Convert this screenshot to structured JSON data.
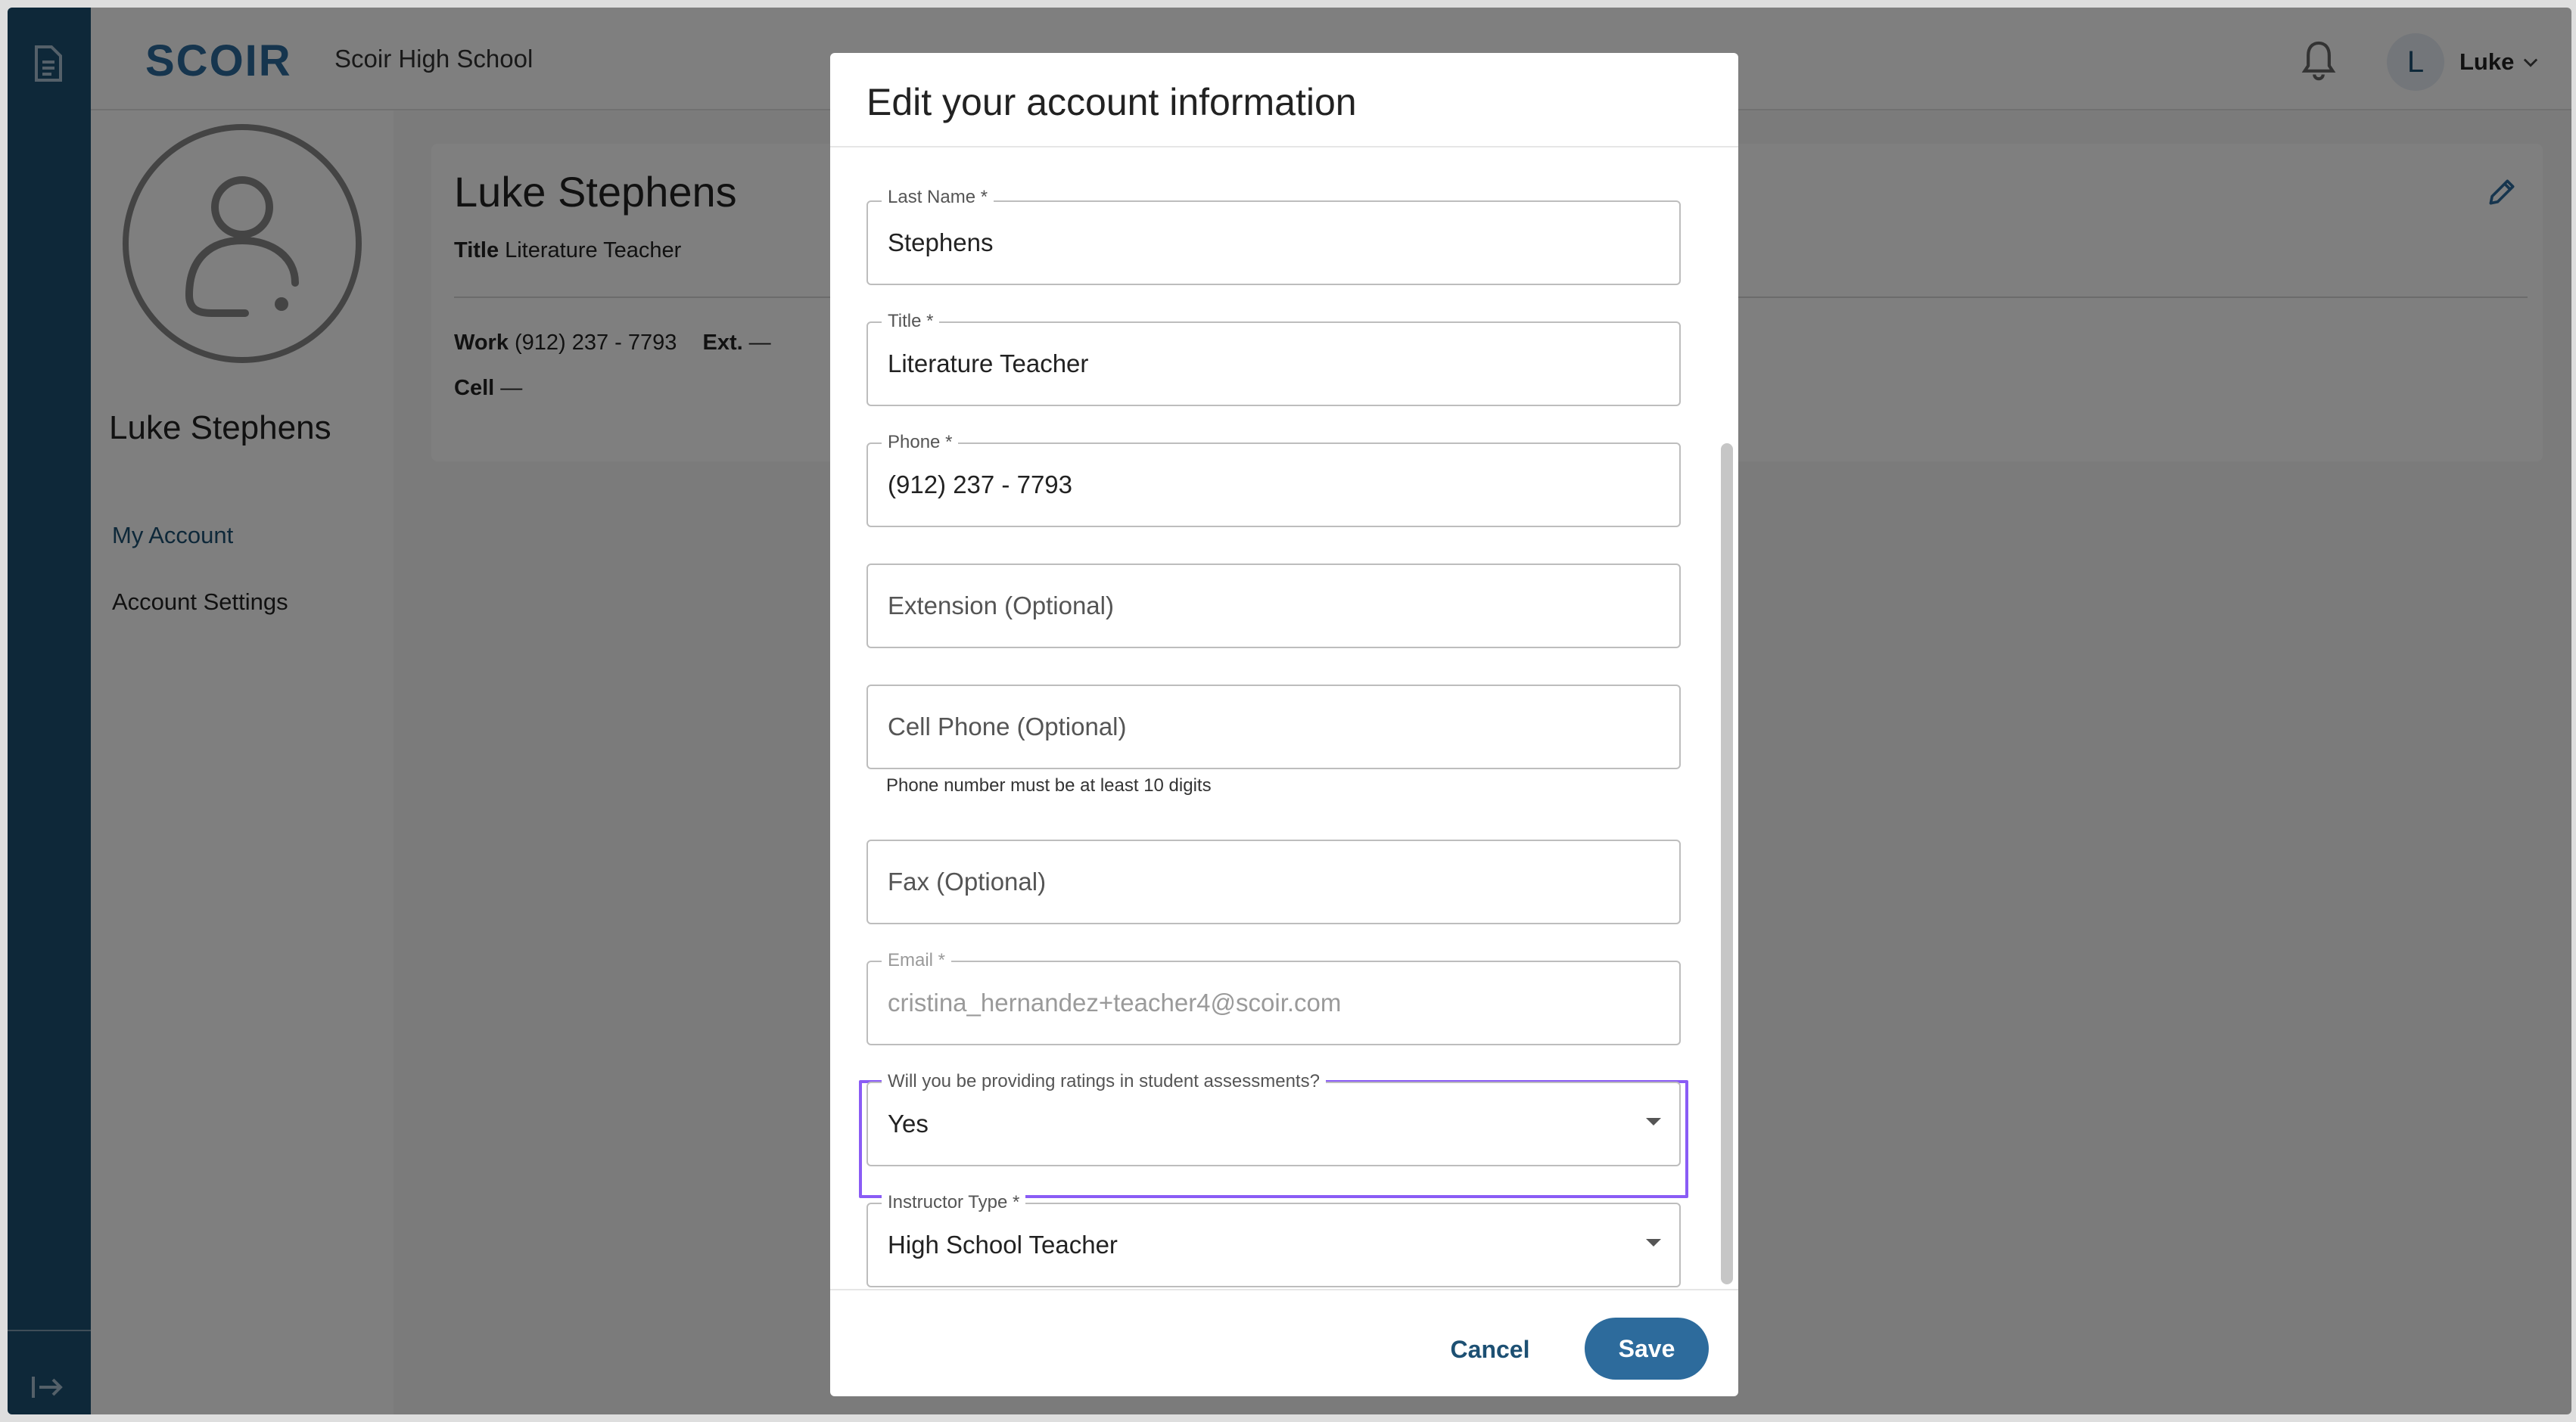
{
  "header": {
    "logo": "SCOIR",
    "school": "Scoir High School",
    "user_initial": "L",
    "user_name": "Luke"
  },
  "profile": {
    "name": "Luke Stephens"
  },
  "nav": {
    "items": [
      {
        "label": "My Account"
      },
      {
        "label": "Account Settings"
      }
    ]
  },
  "card": {
    "name": "Luke Stephens",
    "title_label": "Title",
    "title_value": "Literature Teacher",
    "work_label": "Work",
    "work_value": "(912) 237 - 7793",
    "ext_label": "Ext.",
    "ext_value": "—",
    "cell_label": "Cell",
    "cell_value": "—"
  },
  "modal": {
    "title": "Edit your account information",
    "fields": {
      "last_name": {
        "label": "Last Name *",
        "value": "Stephens"
      },
      "title": {
        "label": "Title *",
        "value": "Literature Teacher"
      },
      "phone": {
        "label": "Phone *",
        "value": "(912) 237 - 7793"
      },
      "extension": {
        "placeholder": "Extension (Optional)"
      },
      "cell_phone": {
        "placeholder": "Cell Phone (Optional)",
        "helper": "Phone number must be at least 10 digits"
      },
      "fax": {
        "placeholder": "Fax (Optional)"
      },
      "email": {
        "label": "Email *",
        "value": "cristina_hernandez+teacher4@scoir.com"
      },
      "ratings": {
        "label": "Will you be providing ratings in student assessments?",
        "value": "Yes"
      },
      "instructor_type": {
        "label": "Instructor Type *",
        "value": "High School Teacher"
      }
    },
    "cancel_label": "Cancel",
    "save_label": "Save"
  },
  "colors": {
    "rail": "#1d5073",
    "accent": "#2d6b9c",
    "highlight": "#8a5cf5"
  },
  "icons": [
    "document-icon",
    "expand-sidebar-icon",
    "bell-icon",
    "chevron-down-icon",
    "user-avatar-icon",
    "pencil-icon",
    "caret-down-icon"
  ]
}
